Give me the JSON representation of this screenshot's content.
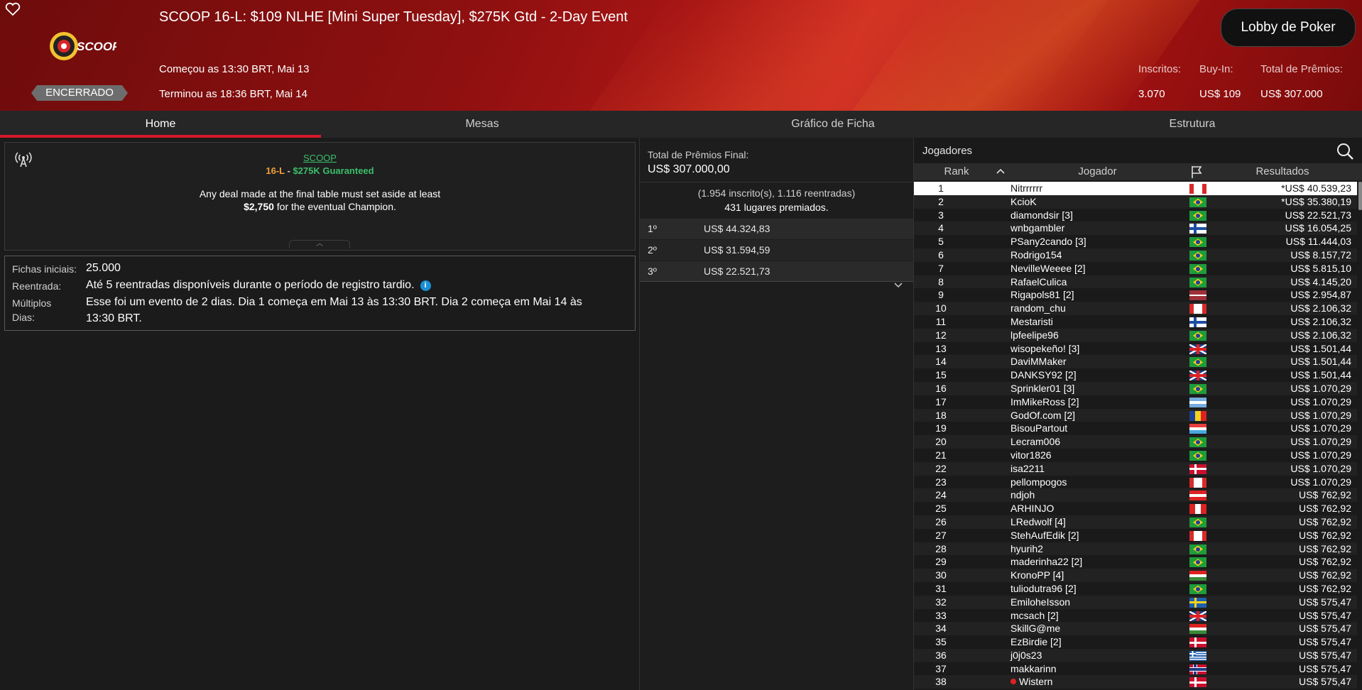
{
  "header": {
    "title": "SCOOP 16-L: $109 NLHE [Mini Super Tuesday], $275K Gtd - 2-Day Event",
    "started": "Começou as 13:30 BRT, Mai 13",
    "ended": "Terminou as 18:36 BRT, Mai 14",
    "status": "ENCERRADO",
    "lobby_button": "Lobby de Poker",
    "logo_text": "SCOOP",
    "stats": {
      "entrants_label": "Inscritos:",
      "entrants_value": "3.070",
      "buyin_label": "Buy-In:",
      "buyin_value": "US$ 109",
      "prize_label": "Total de Prêmios:",
      "prize_value": "US$ 307.000"
    }
  },
  "tabs": [
    {
      "label": "Home",
      "active": true
    },
    {
      "label": "Mesas",
      "active": false
    },
    {
      "label": "Gráfico de Ficha",
      "active": false
    },
    {
      "label": "Estrutura",
      "active": false
    }
  ],
  "promo": {
    "link": "SCOOP",
    "code": "16-L",
    "dash": " - ",
    "guaranteed": "$275K Guaranteed",
    "text_line1": "Any deal made at the final table must set aside at least",
    "text_amount": "$2,750",
    "text_line2_rest": " for the eventual Champion."
  },
  "info": {
    "starting_chips_label": "Fichas iniciais:",
    "starting_chips_value": "25.000",
    "reentry_label": "Reentrada:",
    "reentry_value": "Até 5 reentradas disponíveis durante o período de registro tardio.",
    "multiday_label_1": "Múltiplos",
    "multiday_label_2": "Dias:",
    "multiday_value_1": "Esse foi um evento de 2 dias. Dia 1 começa em Mai 13 às 13:30 BRT. Dia 2 começa em Mai 14 às",
    "multiday_value_2": "13:30 BRT."
  },
  "prizes": {
    "total_label": "Total de Prêmios Final:",
    "total_value": "US$ 307.000,00",
    "entrants_text": "(1.954 inscrito(s), 1.116 reentradas)",
    "places_text": "431 lugares premiados.",
    "rows": [
      {
        "place": "1º",
        "amount": "US$ 44.324,83"
      },
      {
        "place": "2º",
        "amount": "US$ 31.594,59"
      },
      {
        "place": "3º",
        "amount": "US$ 22.521,73"
      }
    ]
  },
  "players": {
    "title": "Jogadores",
    "col_rank": "Rank",
    "col_player": "Jogador",
    "col_results": "Resultados",
    "rows": [
      {
        "rank": "1",
        "name": "Nitrrrrrr",
        "flag": "ca",
        "result": "*US$ 40.539,23"
      },
      {
        "rank": "2",
        "name": "KcioK",
        "flag": "br",
        "result": "*US$ 35.380,19"
      },
      {
        "rank": "3",
        "name": "diamondsir [3]",
        "flag": "br",
        "result": "US$ 22.521,73"
      },
      {
        "rank": "4",
        "name": "wnbgambler",
        "flag": "fi",
        "result": "US$ 16.054,25"
      },
      {
        "rank": "5",
        "name": "PSany2cando [3]",
        "flag": "br",
        "result": "US$ 11.444,03"
      },
      {
        "rank": "6",
        "name": "Rodrigo154",
        "flag": "br",
        "result": "US$ 8.157,72"
      },
      {
        "rank": "7",
        "name": "NevilleWeeee [2]",
        "flag": "br",
        "result": "US$ 5.815,10"
      },
      {
        "rank": "8",
        "name": "RafaelCulica",
        "flag": "br",
        "result": "US$ 4.145,20"
      },
      {
        "rank": "9",
        "name": "Rigapols81 [2]",
        "flag": "lv",
        "result": "US$ 2.954,87"
      },
      {
        "rank": "10",
        "name": "random_chu",
        "flag": "ca",
        "result": "US$ 2.106,32"
      },
      {
        "rank": "11",
        "name": "Mestaristi",
        "flag": "fi",
        "result": "US$ 2.106,32"
      },
      {
        "rank": "12",
        "name": "lpfeelipe96",
        "flag": "br",
        "result": "US$ 2.106,32"
      },
      {
        "rank": "13",
        "name": "wisopekeño! [3]",
        "flag": "gb",
        "result": "US$ 1.501,44"
      },
      {
        "rank": "14",
        "name": "DaviMMaker",
        "flag": "br",
        "result": "US$ 1.501,44"
      },
      {
        "rank": "15",
        "name": "DANKSY92 [2]",
        "flag": "gb",
        "result": "US$ 1.501,44"
      },
      {
        "rank": "16",
        "name": "Sprinkler01 [3]",
        "flag": "br",
        "result": "US$ 1.070,29"
      },
      {
        "rank": "17",
        "name": "ImMikeRoss [2]",
        "flag": "ar",
        "result": "US$ 1.070,29"
      },
      {
        "rank": "18",
        "name": "GodOf.com [2]",
        "flag": "ro",
        "result": "US$ 1.070,29"
      },
      {
        "rank": "19",
        "name": "BisouPartout",
        "flag": "lu",
        "result": "US$ 1.070,29"
      },
      {
        "rank": "20",
        "name": "Lecram006",
        "flag": "br",
        "result": "US$ 1.070,29"
      },
      {
        "rank": "21",
        "name": "vitor1826",
        "flag": "br",
        "result": "US$ 1.070,29"
      },
      {
        "rank": "22",
        "name": "isa2211",
        "flag": "dk",
        "result": "US$ 1.070,29"
      },
      {
        "rank": "23",
        "name": "pellompogos",
        "flag": "ca",
        "result": "US$ 1.070,29"
      },
      {
        "rank": "24",
        "name": "ndjoh",
        "flag": "at",
        "result": "US$ 762,92"
      },
      {
        "rank": "25",
        "name": "ARHINJO",
        "flag": "pe",
        "result": "US$ 762,92"
      },
      {
        "rank": "26",
        "name": "LRedwolf [4]",
        "flag": "br",
        "result": "US$ 762,92"
      },
      {
        "rank": "27",
        "name": "StehAufEdik [2]",
        "flag": "ca",
        "result": "US$ 762,92"
      },
      {
        "rank": "28",
        "name": "hyurih2",
        "flag": "br",
        "result": "US$ 762,92"
      },
      {
        "rank": "29",
        "name": "maderinha22 [2]",
        "flag": "br",
        "result": "US$ 762,92"
      },
      {
        "rank": "30",
        "name": "KronoPP [4]",
        "flag": "hu",
        "result": "US$ 762,92"
      },
      {
        "rank": "31",
        "name": "tuliodutra96 [2]",
        "flag": "br",
        "result": "US$ 762,92"
      },
      {
        "rank": "32",
        "name": "EmiloheIsson",
        "flag": "se",
        "result": "US$ 575,47"
      },
      {
        "rank": "33",
        "name": "mcsach [2]",
        "flag": "gb",
        "result": "US$ 575,47"
      },
      {
        "rank": "34",
        "name": "SkillG@me",
        "flag": "hu",
        "result": "US$ 575,47"
      },
      {
        "rank": "35",
        "name": "EzBirdie [2]",
        "flag": "dk",
        "result": "US$ 575,47"
      },
      {
        "rank": "36",
        "name": "j0j0s23",
        "flag": "gr",
        "result": "US$ 575,47"
      },
      {
        "rank": "37",
        "name": "makkarinn",
        "flag": "no",
        "result": "US$ 575,47"
      },
      {
        "rank": "38",
        "name": "Wistern",
        "flag": "dk",
        "result": "US$ 575,47",
        "badge": true
      }
    ]
  }
}
